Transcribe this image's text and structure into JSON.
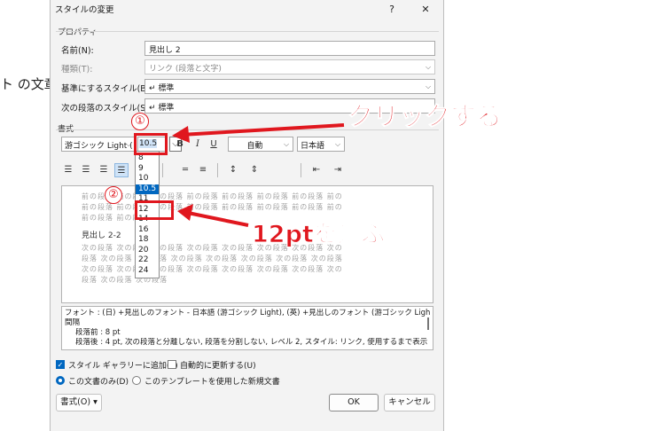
{
  "background": {
    "text": "ト の文章"
  },
  "dialog": {
    "title": "スタイルの変更",
    "help": "?",
    "close": "✕",
    "properties": {
      "section": "プロパティ",
      "name_label": "名前(N):",
      "name_value": "見出し 2",
      "type_label": "種類(T):",
      "type_value": "リンク (段落と文字)",
      "base_label": "基準にするスタイル(B):",
      "base_value": "↵ 標準",
      "next_label": "次の段落のスタイル(S):",
      "next_value": "↵ 標準"
    },
    "format": {
      "section": "書式",
      "font": "游ゴシック Light (",
      "size": "10.5",
      "bold": "B",
      "italic": "I",
      "underline": "U",
      "color": "自動",
      "lang": "日本語"
    },
    "size_options": [
      "8",
      "9",
      "10",
      "10.5",
      "11",
      "12",
      "14",
      "16",
      "18",
      "20",
      "22",
      "24"
    ],
    "size_selected": "10.5",
    "preview": {
      "prev_line1": "前の段落 前の段落 前の段落 前の段落 前の段落 前の段落 前の段落 前の",
      "prev_line2": "前の段落 前の段落 前の段落 前の段落 前の段落 前の段落 前の段落 前の",
      "prev_line3": "前の段落 前の段落",
      "heading": "見出し 2-2",
      "next_line1": "次の段落 次の段落 次の段落 次の段落 次の段落 次の段落 次の段落 次の",
      "next_line2": "段落 次の段落 次の段落 次の段落 次の段落 次の段落 次の段落 次の段落",
      "next_line3": "次の段落 次の段落 次の段落 次の段落 次の段落 次の段落 次の段落 次の",
      "next_line4": "段落 次の段落 次の段落"
    },
    "description": {
      "line1": "フォント : (日) +見出しのフォント - 日本語 (游ゴシック Light), (英) +見出しのフォント (游ゴシック Light),",
      "line2": "間隔",
      "line3": "段落前 :  8 pt",
      "line4": "段落後 :  4 pt, 次の段落と分離しない, 段落を分割しない, レベル 2, スタイル: リンク, 使用するまで表示"
    },
    "add_gallery": "スタイル ギャラリーに追加(S)",
    "auto_update": "自動的に更新する(U)",
    "this_doc": "この文書のみ(D)",
    "new_docs": "このテンプレートを使用した新規文書",
    "format_button": "書式(O) ▾",
    "ok": "OK",
    "cancel": "キャンセル"
  },
  "annotations": {
    "step1": "①",
    "step2": "②",
    "click_text": "クリックする",
    "select_text": "12ptを選ぶ",
    "color": "#e0171e"
  }
}
